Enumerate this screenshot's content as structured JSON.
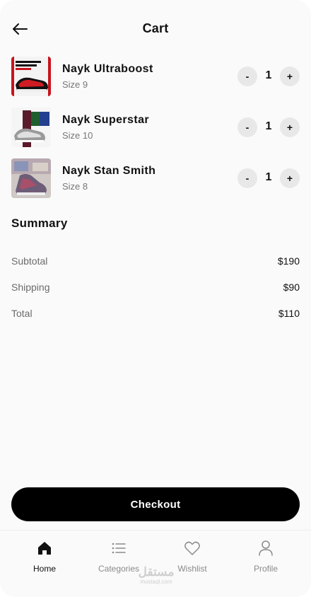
{
  "header": {
    "title": "Cart"
  },
  "cart": {
    "items": [
      {
        "name": "Nayk Ultraboost",
        "size": "Size 9",
        "qty": "1",
        "minus": "-",
        "plus": "+"
      },
      {
        "name": "Nayk Superstar",
        "size": "Size 10",
        "qty": "1",
        "minus": "-",
        "plus": "+"
      },
      {
        "name": "Nayk Stan Smith",
        "size": "Size 8",
        "qty": "1",
        "minus": "-",
        "plus": "+"
      }
    ]
  },
  "summary": {
    "title": "Summary",
    "rows": [
      {
        "label": "Subtotal",
        "value": "$190"
      },
      {
        "label": "Shipping",
        "value": "$90"
      },
      {
        "label": "Total",
        "value": "$110"
      }
    ]
  },
  "checkout": {
    "label": "Checkout"
  },
  "tabbar": {
    "tabs": [
      {
        "label": "Home",
        "icon": "home-icon"
      },
      {
        "label": "Categories",
        "icon": "list-icon"
      },
      {
        "label": "Wishlist",
        "icon": "heart-icon"
      },
      {
        "label": "Profile",
        "icon": "user-icon"
      }
    ]
  },
  "watermark": {
    "arabic": "مستقل",
    "url": "mostaql.com"
  },
  "colors": {
    "accent": "#000000",
    "background": "#fafafa",
    "muted": "#777777",
    "qty_button": "#e8e8e8"
  }
}
